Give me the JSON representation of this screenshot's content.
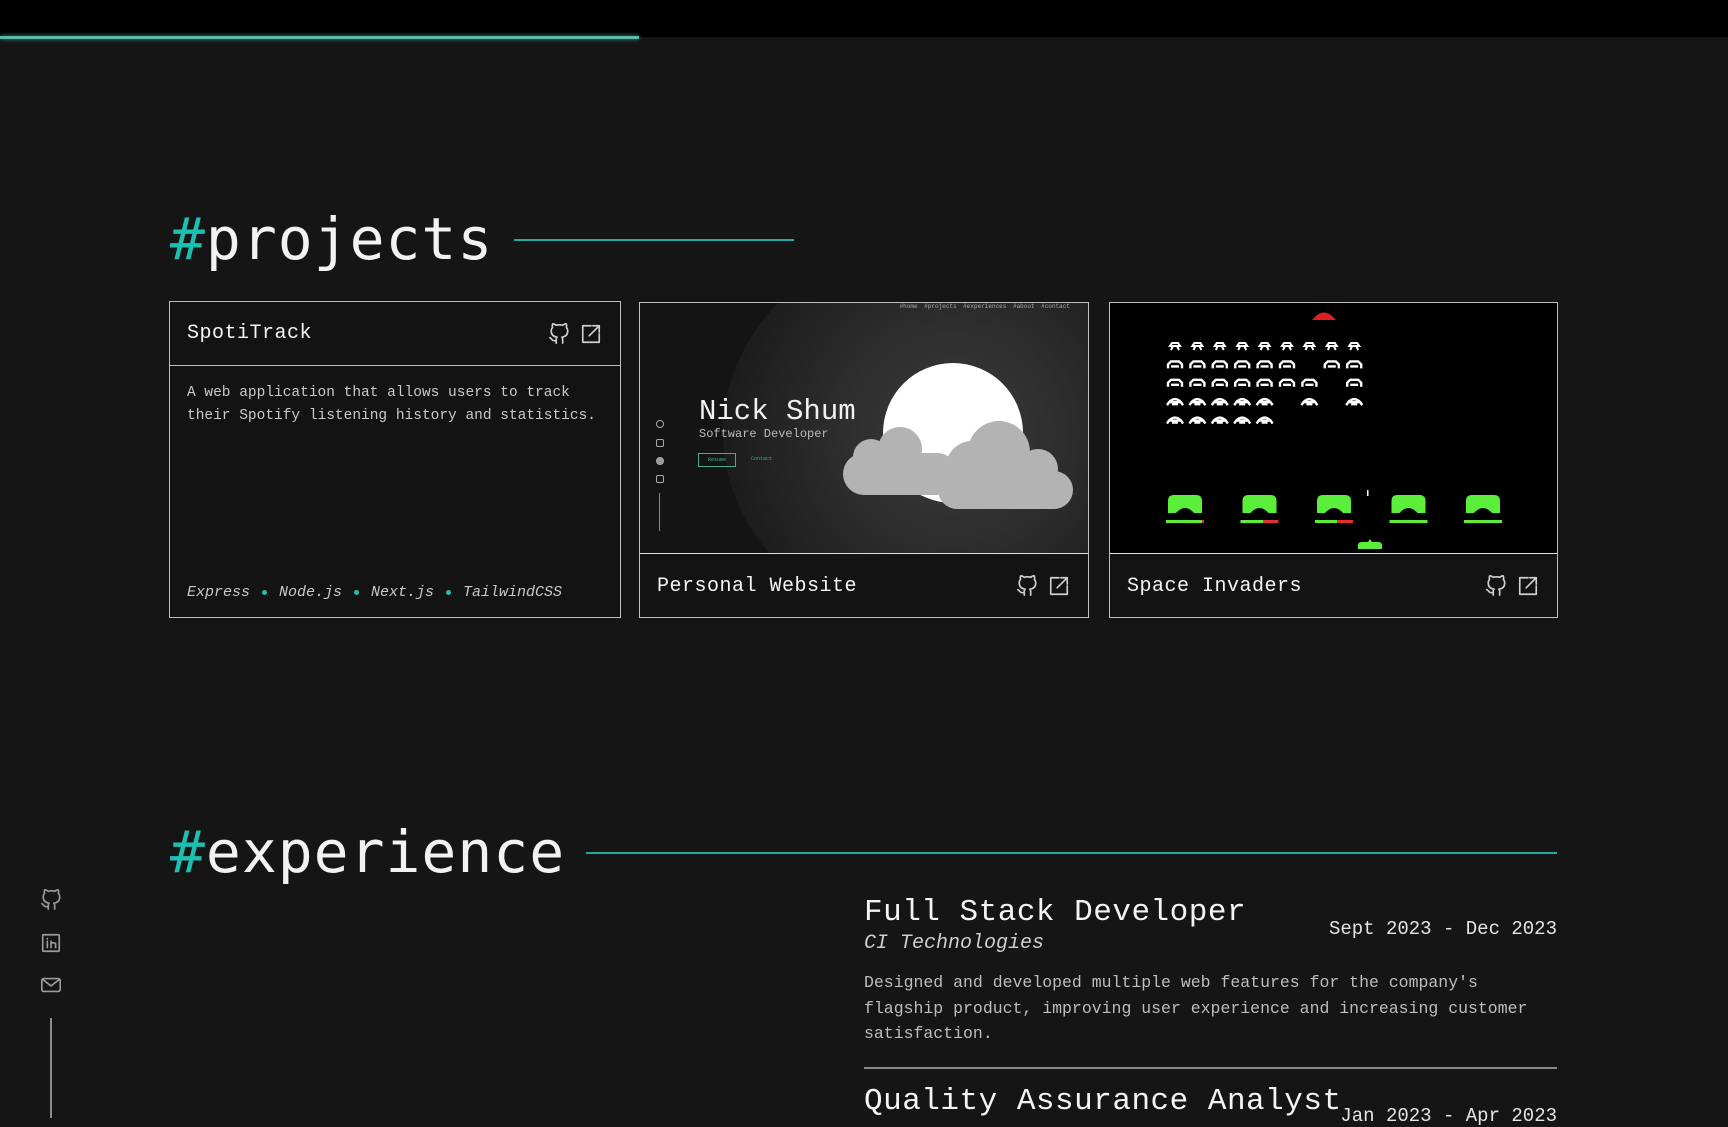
{
  "scroll_progress": 0.37,
  "colors": {
    "accent": "#1fbfb0",
    "background": "#151515",
    "progress": "#5fb8a5"
  },
  "projects": {
    "hash": "#",
    "title": "projects",
    "cards": [
      {
        "title": "SpotiTrack",
        "description": "A web application that allows users to track their Spotify listening history and statistics.",
        "tags": [
          "Express",
          "Node.js",
          "Next.js",
          "TailwindCSS"
        ],
        "icons": [
          "github-icon",
          "external-link-icon"
        ]
      },
      {
        "title": "Personal Website",
        "icons": [
          "github-icon",
          "external-link-icon"
        ],
        "preview": {
          "nav": "#home #projects #experiences #about #contact",
          "name": "Nick Shum",
          "role": "Software Developer",
          "buttons": [
            "Resume",
            "Contact"
          ]
        }
      },
      {
        "title": "Space Invaders",
        "icons": [
          "github-icon",
          "external-link-icon"
        ],
        "preview": {
          "invader_rows": [
            [
              1,
              1,
              1,
              1,
              1,
              1,
              1,
              1,
              1
            ],
            [
              1,
              1,
              1,
              1,
              1,
              1,
              0,
              1,
              1
            ],
            [
              1,
              1,
              1,
              1,
              1,
              1,
              1,
              0,
              1
            ],
            [
              1,
              1,
              1,
              1,
              1,
              0,
              1,
              0,
              1
            ],
            [
              1,
              1,
              1,
              1,
              1,
              0,
              0,
              0,
              0
            ]
          ],
          "bunker_health": [
            0.95,
            0.6,
            0.58,
            1,
            1
          ]
        }
      }
    ]
  },
  "experience": {
    "hash": "#",
    "title": "experience",
    "items": [
      {
        "title": "Full Stack Developer",
        "company": "CI Technologies",
        "dates": "Sept 2023 - Dec 2023",
        "description": "Designed and developed multiple web features for the company's flagship product, improving user experience and increasing customer satisfaction."
      },
      {
        "title": "Quality Assurance Analyst",
        "dates": "Jan 2023 - Apr 2023"
      }
    ]
  },
  "sidebar": {
    "icons": [
      "github-icon",
      "linkedin-icon",
      "mail-icon"
    ]
  }
}
